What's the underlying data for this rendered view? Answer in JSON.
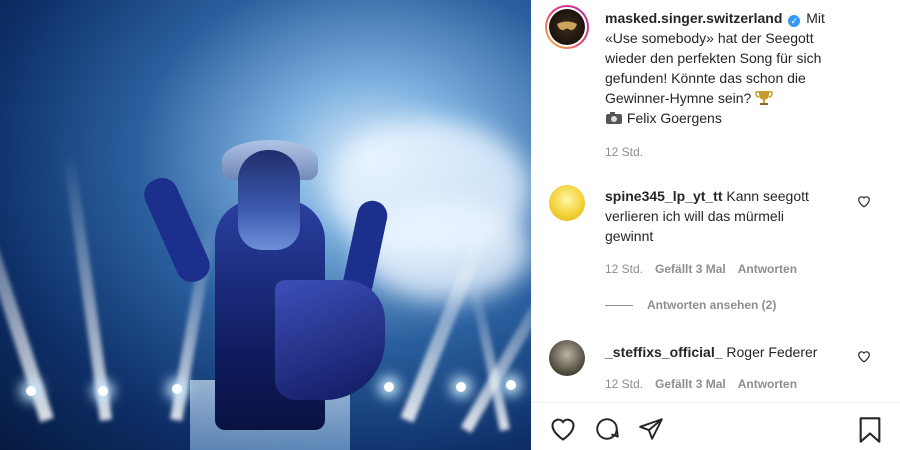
{
  "post": {
    "author": "masked.singer.switzerland",
    "caption_lines": [
      "Mit",
      "«Use somebody» hat der Seegott",
      "wieder den perfekten Song für sich",
      "gefunden! Könnte das schon die",
      "Gewinner-Hymne sein?"
    ],
    "credit": "Felix Goergens",
    "time": "12 Std."
  },
  "comments": [
    {
      "user": "spine345_lp_yt_tt",
      "lines": [
        "Kann seegott",
        "verlieren ich will das mürmeli",
        "gewinnt"
      ],
      "time": "12 Std.",
      "likes": "Gefällt 3 Mal",
      "reply": "Antworten",
      "view_replies": "Antworten ansehen (2)"
    },
    {
      "user": "_steffixs_official_",
      "text": "Roger Federer",
      "time": "12 Std.",
      "likes": "Gefällt 3 Mal",
      "reply": "Antworten"
    }
  ],
  "colors": {
    "verified": "#3897f0",
    "muted": "#8e8e8e",
    "text": "#262626"
  },
  "icons": [
    "heart-icon",
    "comment-icon",
    "share-icon",
    "bookmark-icon",
    "trophy-icon",
    "camera-icon"
  ]
}
